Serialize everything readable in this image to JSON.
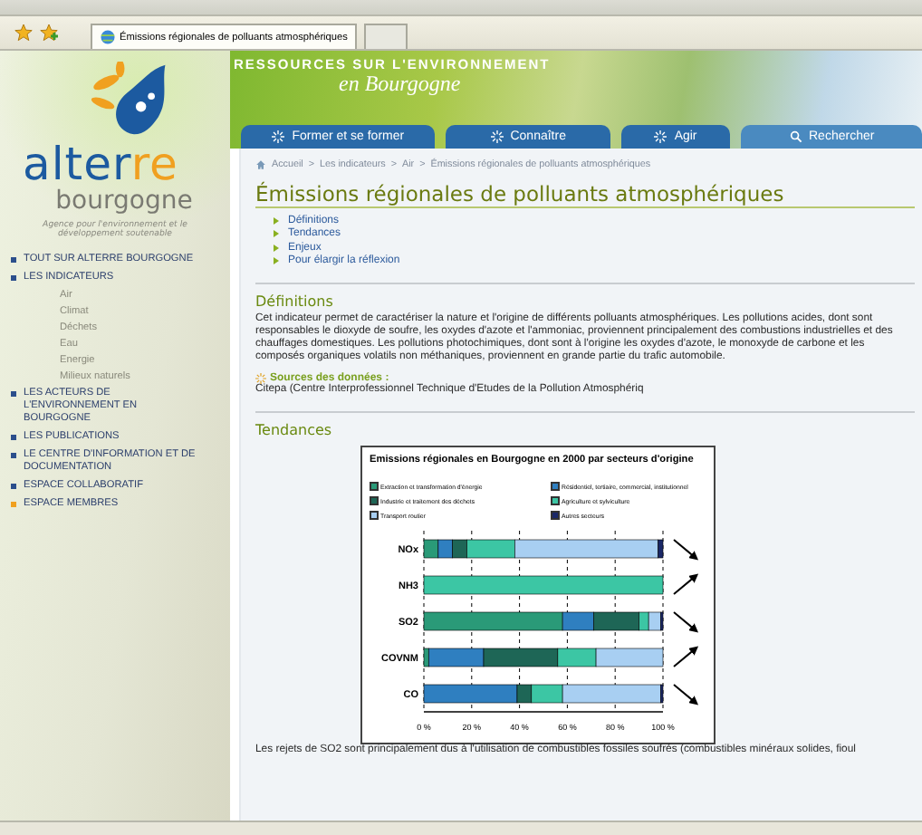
{
  "browser": {
    "tabs": [
      {
        "label": "Émissions régionales de polluants atmosphériques",
        "selected": true
      },
      {
        "selected": false
      }
    ]
  },
  "logo": {
    "name": "alter",
    "accent": "re",
    "region": "bourgogne",
    "tagline": "Agence pour l'environnement et le développement soutenable"
  },
  "banner": {
    "title": "RESSOURCES SUR L'ENVIRONNEMENT",
    "subtitle": "en Bourgogne"
  },
  "nav": [
    {
      "label": "Former et se former",
      "kind": "section"
    },
    {
      "label": "Connaître",
      "kind": "section"
    },
    {
      "label": "Agir",
      "kind": "section"
    },
    {
      "label": "Rechercher",
      "kind": "search"
    }
  ],
  "sidebar": {
    "items": [
      {
        "label": "TOUT SUR ALTERRE BOURGOGNE",
        "color": "#2c4f8c"
      },
      {
        "label": "LES INDICATEURS",
        "color": "#2c4f8c",
        "children": [
          {
            "label": "Air"
          },
          {
            "label": "Climat"
          },
          {
            "label": "Déchets"
          },
          {
            "label": "Eau"
          },
          {
            "label": "Energie"
          },
          {
            "label": "Milieux naturels"
          }
        ]
      },
      {
        "label": "LES ACTEURS DE L'ENVIRONNEMENT EN BOURGOGNE",
        "color": "#2c4f8c"
      },
      {
        "label": "LES PUBLICATIONS",
        "color": "#2c4f8c"
      },
      {
        "label": "LE CENTRE D'INFORMATION ET DE DOCUMENTATION",
        "color": "#2c4f8c"
      },
      {
        "label": "ESPACE COLLABORATIF",
        "color": "#2c4f8c"
      },
      {
        "label": "ESPACE MEMBRES",
        "color": "#f0a020"
      }
    ]
  },
  "breadcrumb": [
    "Accueil",
    "Les indicateurs",
    "Air",
    "Émissions régionales de polluants atmosphériques"
  ],
  "breadcrumb_separator": ">",
  "page_title": "Émissions régionales de polluants atmosphériques",
  "toc": [
    "Définitions",
    "Tendances",
    "Enjeux",
    "Pour élargir la réflexion"
  ],
  "sections": [
    {
      "heading": "Définitions",
      "text": "Cet indicateur permet de caractériser la nature et l'origine de différents polluants atmosphériques. Les pollutions acides, dont sont responsables le dioxyde de soufre, les oxydes d'azote et l'ammoniac, proviennent principalement des combustions industrielles et des chauffages domestiques. Les pollutions photochimiques, dont sont à l'origine les oxydes d'azote, le monoxyde de carbone et les composés organiques volatils non méthaniques, proviennent en grande partie du trafic automobile.",
      "sources_heading": "Sources des données :",
      "sources_text": "Citepa (Centre Interprofessionnel Technique d'Etudes de la Pollution Atmosphériq"
    },
    {
      "heading": "Tendances",
      "chart_data": {
        "type": "bar",
        "orientation": "horizontal",
        "stacked": true,
        "title": "Emissions régionales en Bourgogne en 2000 par secteurs d'origine",
        "categories": [
          "NOx",
          "NH3",
          "SO2",
          "COVNM",
          "CO"
        ],
        "series": [
          {
            "name": "Extraction et transformation d'énergie",
            "color": "#2a9a78",
            "values": [
              6,
              0,
              58,
              2,
              0
            ]
          },
          {
            "name": "Résidentiel, tertiaire, commercial, institutionnel",
            "color": "#2f7fc0",
            "values": [
              6,
              0,
              13,
              23,
              39
            ]
          },
          {
            "name": "Industrie et traitement des déchets",
            "color": "#1e6656",
            "values": [
              6,
              0,
              19,
              31,
              6
            ]
          },
          {
            "name": "Agriculture et sylviculture",
            "color": "#3cc6a4",
            "values": [
              20,
              100,
              4,
              16,
              13
            ]
          },
          {
            "name": "Transport routier",
            "color": "#a8cff2",
            "values": [
              60,
              0,
              5,
              28,
              41
            ]
          },
          {
            "name": "Autres secteurs",
            "color": "#1a2868",
            "values": [
              2,
              0,
              1,
              0,
              1
            ]
          }
        ],
        "xlim": [
          0,
          100
        ],
        "xticks": [
          {
            "value": 0,
            "label": "0 %"
          },
          {
            "value": 20,
            "label": "20 %"
          },
          {
            "value": 40,
            "label": "40 %"
          },
          {
            "value": 60,
            "label": "60 %"
          },
          {
            "value": 80,
            "label": "80 %"
          },
          {
            "value": 100,
            "label": "100 %"
          }
        ],
        "grid": true,
        "legend": true
      },
      "trends": [
        {
          "rising": false
        },
        {
          "rising": true
        },
        {
          "rising": false
        },
        {
          "rising": true
        },
        {
          "rising": false
        }
      ],
      "text": "Les rejets de SO2 sont principalement dus à l'utilisation de combustibles fossiles soufrés (combustibles minéraux solides, fioul"
    }
  ]
}
